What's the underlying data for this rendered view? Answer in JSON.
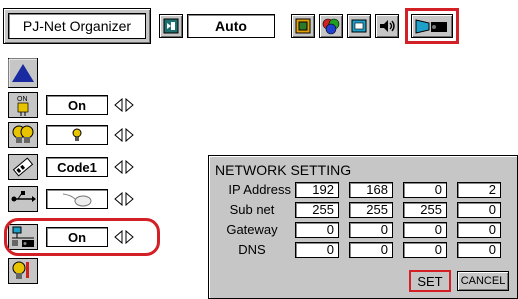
{
  "app": {
    "title": "PJ-Net Organizer"
  },
  "toolbar": {
    "input_value": "Auto",
    "icons": [
      "input-icon",
      "image-icon",
      "color-icon",
      "screen-icon",
      "sound-icon",
      "setting-icon"
    ]
  },
  "side_menu": {
    "items": [
      {
        "icon": "power-icon",
        "value": "On"
      },
      {
        "icon": "lamp-icon",
        "value": "♀"
      },
      {
        "icon": "remote-control-icon",
        "value": "Code1"
      },
      {
        "icon": "usb-mouse-icon",
        "value": ""
      },
      {
        "icon": "network-icon",
        "value": "On"
      },
      {
        "icon": "filter-icon",
        "value": ""
      }
    ]
  },
  "network_setting": {
    "title": "NETWORK SETTING",
    "rows": [
      {
        "label": "IP Address",
        "octets": [
          "192",
          "168",
          "0",
          "2"
        ]
      },
      {
        "label": "Sub net",
        "octets": [
          "255",
          "255",
          "255",
          "0"
        ]
      },
      {
        "label": "Gateway",
        "octets": [
          "0",
          "0",
          "0",
          "0"
        ]
      },
      {
        "label": "DNS",
        "octets": [
          "0",
          "0",
          "0",
          "0"
        ]
      }
    ],
    "set_label": "SET",
    "cancel_label": "CANCEL"
  },
  "colors": {
    "highlight": "#d32026",
    "panel": "#c6c6c6"
  }
}
